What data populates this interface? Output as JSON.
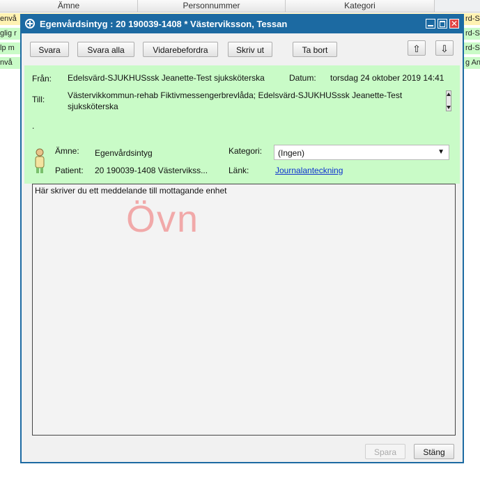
{
  "background": {
    "columns": [
      "Ämne",
      "Personnummer",
      "Kategori"
    ],
    "rows": [
      {
        "left": "envå",
        "right": "rd-S"
      },
      {
        "left": "glig r",
        "right": "rd-S"
      },
      {
        "left": "lp m",
        "right": "rd-S"
      },
      {
        "left": "nvå",
        "right": "g An"
      }
    ]
  },
  "dialog": {
    "title": "Egenvårdsintyg : 20 190039-1408 * Västerviksson, Tessan",
    "close_glyph": "✕",
    "toolbar": {
      "reply": "Svara",
      "reply_all": "Svara alla",
      "forward": "Vidarebefordra",
      "print": "Skriv ut",
      "delete": "Ta bort",
      "up_glyph": "⇧",
      "down_glyph": "⇩"
    },
    "header": {
      "from_label": "Från:",
      "from_value": "Edelsvärd-SJUKHUSssk Jeanette-Test sjuksköterska",
      "date_label": "Datum:",
      "date_value": "torsdag 24 oktober 2019 14:41",
      "to_label": "Till:",
      "to_value_line1": "Västervikkommun-rehab Fiktivmessengerbrevlåda; Edelsvärd-SJUKHUSssk Jeanette-Test",
      "to_value_line2": "sjuksköterska",
      "dot": ".",
      "subject_label": "Ämne:",
      "subject_value": "Egenvårdsintyg",
      "category_label": "Kategori:",
      "category_value": "(Ingen)",
      "patient_label": "Patient:",
      "patient_value": "20 190039-1408 Västervikss...",
      "link_label": "Länk:",
      "link_value": "Journalanteckning"
    },
    "message": {
      "placeholder": "Här skriver du ett meddelande till mottagande enhet",
      "watermark": "Övn"
    },
    "footer": {
      "save": "Spara",
      "close": "Stäng"
    }
  }
}
